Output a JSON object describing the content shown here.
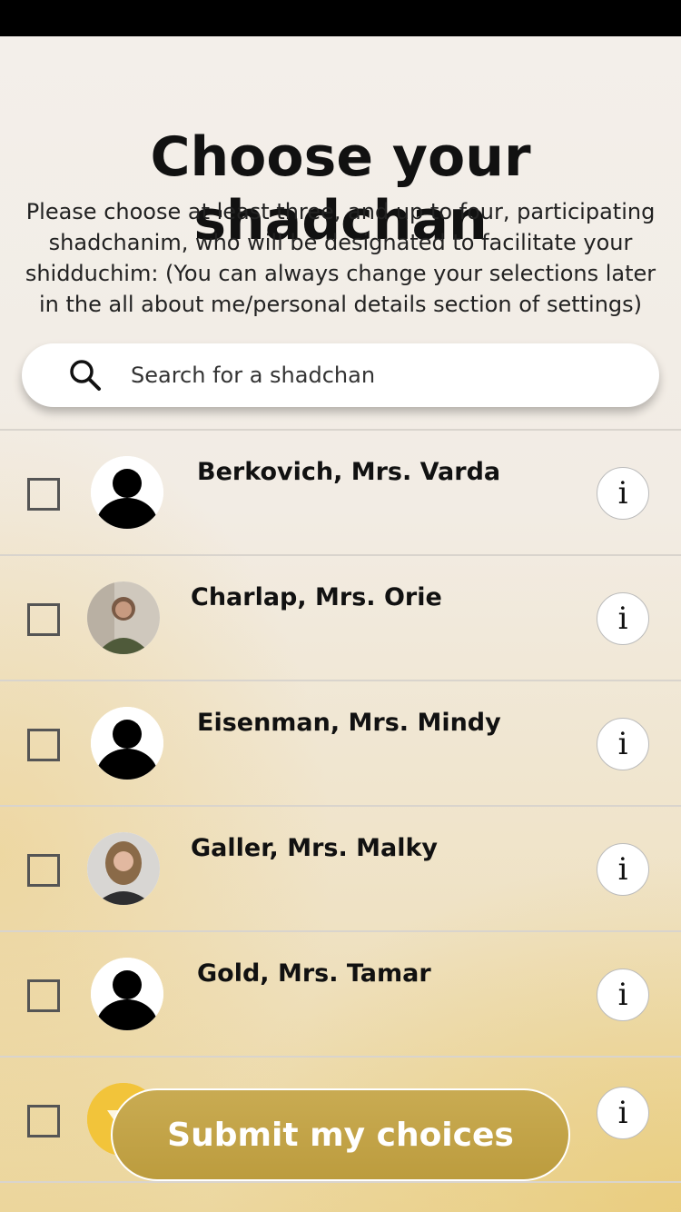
{
  "title": "Choose your shadchan",
  "subtitle_lines": [
    "Please choose at least three, and up to four, participating",
    "shadchanim, who will be designated to facilitate your",
    "shidduchim: (You can always change  your selections later",
    "in the all about me/personal details section of settings)"
  ],
  "search": {
    "placeholder": "Search for a shadchan",
    "value": ""
  },
  "shadchanim": [
    {
      "name": "Berkovich, Mrs. Varda",
      "checked": false,
      "avatar": "default-silhouette",
      "info_label": "i"
    },
    {
      "name": "Charlap, Mrs. Orie",
      "checked": false,
      "avatar": "photo",
      "info_label": "i"
    },
    {
      "name": "Eisenman, Mrs. Mindy",
      "checked": false,
      "avatar": "default-silhouette",
      "info_label": "i"
    },
    {
      "name": "Galler, Mrs. Malky",
      "checked": false,
      "avatar": "photo",
      "info_label": "i"
    },
    {
      "name": "Gold, Mrs. Tamar",
      "checked": false,
      "avatar": "default-silhouette",
      "info_label": "i"
    },
    {
      "name": "",
      "checked": false,
      "avatar": "yellow-partial",
      "info_label": "i"
    }
  ],
  "submit_label": "Submit my choices",
  "colors": {
    "submit_gold": "#c2a248",
    "background": "#f3eee8",
    "accent_yellow": "#ecd79f"
  }
}
